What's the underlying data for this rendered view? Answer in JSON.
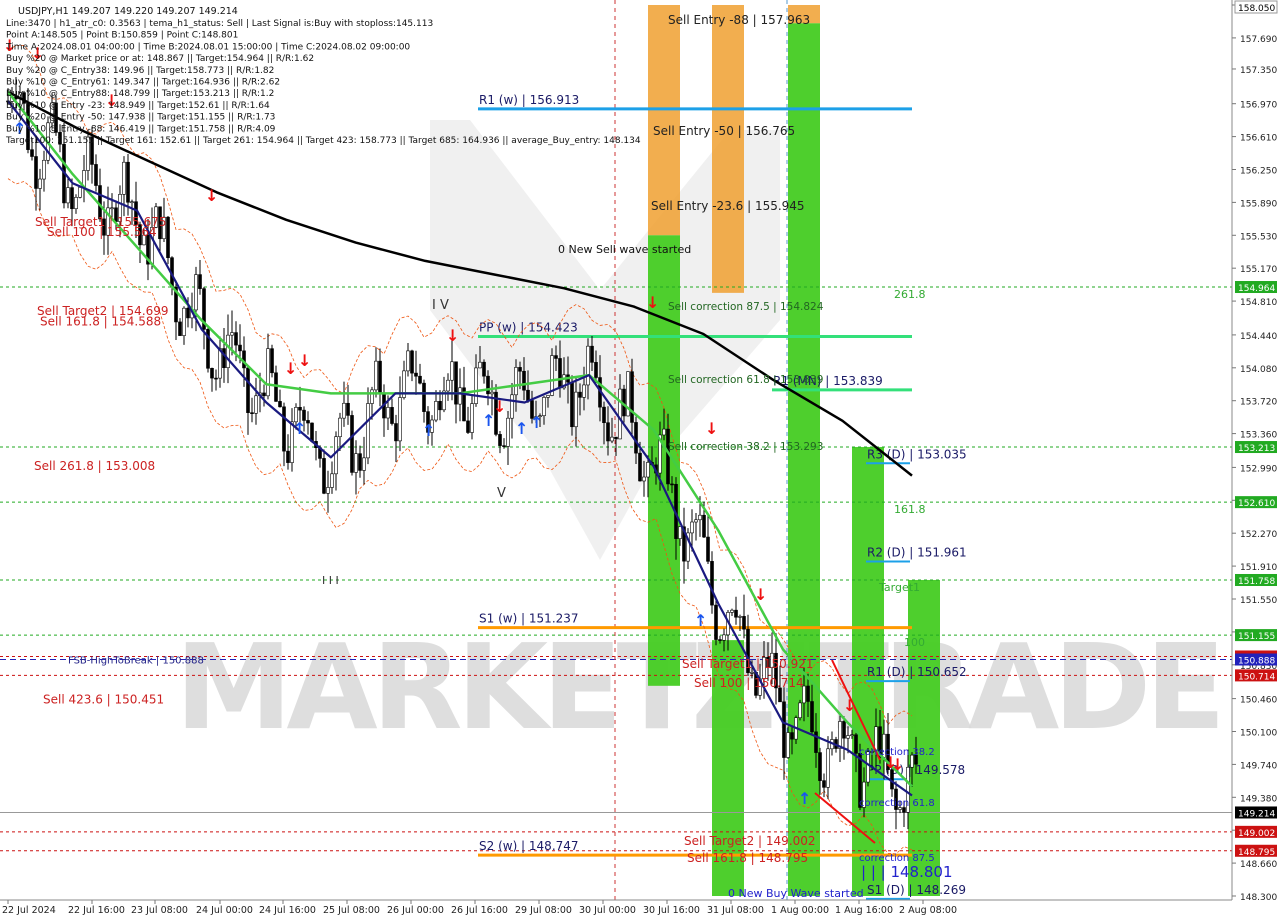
{
  "window": {
    "symbol_line": "USDJPY,H1  149.207 149.220 149.207 149.214"
  },
  "info_lines": [
    "Line:3470  | h1_atr_c0: 0.3563  | tema_h1_status: Sell  | Last Signal is:Buy with stoploss:145.113",
    "Point A:148.505  | Point B:150.859  | Point C:148.801",
    "Time A:2024.08.01 04:00:00  | Time B:2024.08.01 15:00:00  | Time C:2024.08.02 09:00:00",
    "Buy %20 @ Market price or at: 148.867  || Target:154.964  || R/R:1.62",
    "Buy %20 @ C_Entry38: 149.96  || Target:158.773  || R/R:1.82",
    "Buy %10 @ C_Entry61: 149.347  || Target:164.936  || R/R:2.62",
    "Buy %10 @ C_Entry88: 148.799  || Target:153.213  || R/R:1.2",
    "Buy %10 @ Entry -23: 148.949  || Target:152.61  || R/R:1.64",
    "Buy %20 @ Entry -50: 147.938  || Target:151.155  || R/R:1.73",
    "Buy %10 @ Entry -88: 146.419  || Target:151.758  || R/R:4.09",
    "Target100: 151.155  || Target 161: 152.61  || Target 261: 154.964  || Target 423: 158.773  || Target 685: 164.936  || average_Buy_entry: 148.134"
  ],
  "chart_data": {
    "type": "candlestick",
    "symbol": "USDJPY",
    "timeframe": "H1",
    "bid": 149.214,
    "price_axis": {
      "min": 148.3,
      "max": 158.05,
      "ticks": [
        158.05,
        157.69,
        157.35,
        156.97,
        156.61,
        156.25,
        155.89,
        155.53,
        155.17,
        154.81,
        154.44,
        154.08,
        153.72,
        153.36,
        152.99,
        152.63,
        152.27,
        151.91,
        151.55,
        151.19,
        150.83,
        150.46,
        150.1,
        149.74,
        149.38,
        149.02,
        148.66,
        148.3
      ]
    },
    "time_axis": [
      "22 Jul 2024",
      "22 Jul 16:00",
      "23 Jul 08:00",
      "24 Jul 00:00",
      "24 Jul 16:00",
      "25 Jul 08:00",
      "26 Jul 00:00",
      "26 Jul 16:00",
      "29 Jul 08:00",
      "30 Jul 00:00",
      "30 Jul 16:00",
      "31 Jul 08:00",
      "1 Aug 00:00",
      "1 Aug 16:00",
      "2 Aug 08:00"
    ],
    "price_tags": [
      {
        "value": "158.050",
        "color": "#ffffff",
        "text": "#000000"
      },
      {
        "value": "154.964",
        "color": "#22aa22",
        "text": "#ffffff"
      },
      {
        "value": "153.213",
        "color": "#22aa22",
        "text": "#ffffff"
      },
      {
        "value": "152.610",
        "color": "#22aa22",
        "text": "#ffffff"
      },
      {
        "value": "151.758",
        "color": "#22aa22",
        "text": "#ffffff"
      },
      {
        "value": "151.155",
        "color": "#22aa22",
        "text": "#ffffff"
      },
      {
        "value": "150.921",
        "color": "#cc1111",
        "text": "#ffffff"
      },
      {
        "value": "150.888",
        "color": "#2222bb",
        "text": "#ffffff"
      },
      {
        "value": "150.714",
        "color": "#cc1111",
        "text": "#ffffff"
      },
      {
        "value": "149.214",
        "color": "#000000",
        "text": "#ffffff"
      },
      {
        "value": "149.002",
        "color": "#cc1111",
        "text": "#ffffff"
      },
      {
        "value": "148.795",
        "color": "#cc1111",
        "text": "#ffffff"
      }
    ],
    "horizontal_lines": [
      {
        "price": 154.964,
        "style": "dotted",
        "color": "#22aa22"
      },
      {
        "price": 153.213,
        "style": "dotted",
        "color": "#22aa22"
      },
      {
        "price": 152.61,
        "style": "dotted",
        "color": "#22aa22"
      },
      {
        "price": 151.758,
        "style": "dotted",
        "color": "#22aa22"
      },
      {
        "price": 151.155,
        "style": "dotted",
        "color": "#22aa22"
      },
      {
        "price": 150.921,
        "style": "dotted",
        "color": "#cc1111"
      },
      {
        "price": 150.888,
        "style": "dashed",
        "color": "#2222bb"
      },
      {
        "price": 150.714,
        "style": "dotted",
        "color": "#cc1111"
      },
      {
        "price": 149.214,
        "style": "solid",
        "color": "#999999"
      },
      {
        "price": 149.002,
        "style": "dotted",
        "color": "#cc1111"
      },
      {
        "price": 148.795,
        "style": "dotted",
        "color": "#cc1111"
      }
    ],
    "levels": [
      {
        "label": "R1 (w) | 156.913",
        "price": 156.913,
        "color": "#1ca0e8",
        "from": "26 Jul 16:00",
        "to": "1 Aug 16:00"
      },
      {
        "label": "PP (w) | 154.423",
        "price": 154.423,
        "color": "#33e07a",
        "from": "26 Jul 16:00",
        "to": "1 Aug 16:00"
      },
      {
        "label": "S1 (w) | 151.237",
        "price": 151.237,
        "color": "#ff9a00",
        "from": "26 Jul 16:00",
        "to": "1 Aug 16:00"
      },
      {
        "label": "S2 (w) | 148.747",
        "price": 148.747,
        "color": "#ff9a00",
        "from": "26 Jul 16:00",
        "to": "1 Aug 16:00"
      },
      {
        "label": "R1 (MN) | 153.839",
        "price": 153.839,
        "color": "#33e07a",
        "from": "31 Jul 08:00",
        "to": "1 Aug 16:00"
      },
      {
        "label": "R3 (D) | 153.035",
        "price": 153.035,
        "color": "#1ca0e8",
        "from": "1 Aug 16:00",
        "to": "2 Aug 08:00"
      },
      {
        "label": "R2 (D) | 151.961",
        "price": 151.961,
        "color": "#1ca0e8",
        "from": "1 Aug 16:00",
        "to": "2 Aug 08:00"
      },
      {
        "label": "R1 (D) | 150.652",
        "price": 150.652,
        "color": "#1ca0e8",
        "from": "1 Aug 16:00",
        "to": "2 Aug 08:00"
      },
      {
        "label": "PP (D) | 149.578",
        "price": 149.578,
        "color": "#1ca0e8",
        "from": "1 Aug 16:00",
        "to": "2 Aug 08:00"
      },
      {
        "label": "S1 (D) | 148.269",
        "price": 148.269,
        "color": "#1ca0e8",
        "from": "1 Aug 16:00",
        "to": "2 Aug 08:00"
      }
    ],
    "left_labels": [
      {
        "text": "Sell Target1 | 155.675",
        "price": 155.675,
        "color": "#cc2222"
      },
      {
        "text": "Sell 100 | 155.564",
        "price": 155.564,
        "color": "#cc2222"
      },
      {
        "text": "Sell Target2 | 154.699",
        "price": 154.699,
        "color": "#cc2222"
      },
      {
        "text": "Sell 161.8 | 154.588",
        "price": 154.588,
        "color": "#cc2222"
      },
      {
        "text": "Sell  261.8 | 153.008",
        "price": 153.008,
        "color": "#cc2222"
      },
      {
        "text": "FSB-HighToBreak | 150.888",
        "price": 150.888,
        "color": "#222288"
      },
      {
        "text": "Sell  423.6 | 150.451",
        "price": 150.451,
        "color": "#cc2222"
      }
    ],
    "annotations": [
      {
        "text": "Sell Entry -88 | 157.963",
        "color": "#222222"
      },
      {
        "text": "Sell Entry -50 | 156.765",
        "color": "#222222"
      },
      {
        "text": "Sell Entry -23.6 | 155.945",
        "color": "#222222"
      },
      {
        "text": "0 New Sell wave started",
        "color": "#111111"
      },
      {
        "text": "Sell correction 87.5 | 154.824",
        "color": "#226622"
      },
      {
        "text": "Sell correction 61.8 | 153.839",
        "color": "#226622"
      },
      {
        "text": "Sell correction 38.2 | 153.293",
        "color": "#226622"
      },
      {
        "text": "261.8",
        "color": "#33aa33"
      },
      {
        "text": "161.8",
        "color": "#33aa33"
      },
      {
        "text": "Target1",
        "color": "#33aa33"
      },
      {
        "text": "100",
        "color": "#33aa33"
      },
      {
        "text": "Sell Target1 | 150.921",
        "color": "#cc2222"
      },
      {
        "text": "Sell 100 | 150.714",
        "color": "#cc2222"
      },
      {
        "text": "Sell Target2 | 149.002",
        "color": "#cc2222"
      },
      {
        "text": "Sell 161.8 | 148.795",
        "color": "#cc2222"
      },
      {
        "text": "correction 38.2",
        "color": "#2222cc"
      },
      {
        "text": "correction 61.8",
        "color": "#2222cc"
      },
      {
        "text": "correction 87.5",
        "color": "#2222cc"
      },
      {
        "text": "| | | 148.801",
        "color": "#2222cc"
      },
      {
        "text": "0 New Buy Wave started",
        "color": "#2222cc"
      },
      {
        "text": "V",
        "color": "#333333"
      },
      {
        "text": "I V",
        "color": "#333333"
      },
      {
        "text": "I I I",
        "color": "#333333"
      }
    ],
    "zones": [
      {
        "kind": "sell_entry",
        "color": "#f0a030",
        "x_from": "30 Jul 16:00",
        "x_to": "30 Jul 22:00",
        "price_from": 155.53,
        "price_to": 158.05
      },
      {
        "kind": "sell_entry",
        "color": "#f0a030",
        "x_from": "31 Jul 08:00",
        "x_to": "31 Jul 14:00",
        "price_from": 154.9,
        "price_to": 158.05
      },
      {
        "kind": "sell_entry",
        "color": "#f0a030",
        "x_from": "1 Aug 03:00",
        "x_to": "1 Aug 09:00",
        "price_from": 157.85,
        "price_to": 158.05
      },
      {
        "kind": "buy_target",
        "color": "#44cc22",
        "x_from": "30 Jul 16:00",
        "x_to": "30 Jul 22:00",
        "price_from": 150.6,
        "price_to": 155.53
      },
      {
        "kind": "buy_target",
        "color": "#44cc22",
        "x_from": "31 Jul 08:00",
        "x_to": "31 Jul 14:00",
        "price_from": 148.3,
        "price_to": 151.1
      },
      {
        "kind": "buy_target",
        "color": "#44cc22",
        "x_from": "1 Aug 03:00",
        "x_to": "1 Aug 09:00",
        "price_from": 148.3,
        "price_to": 157.85
      },
      {
        "kind": "buy_target",
        "color": "#44cc22",
        "x_from": "1 Aug 19:00",
        "x_to": "2 Aug 01:00",
        "price_from": 148.3,
        "price_to": 153.213
      },
      {
        "kind": "buy_target",
        "color": "#44cc22",
        "x_from": "2 Aug 09:00",
        "x_to": "2 Aug 15:00",
        "price_from": 148.3,
        "price_to": 151.758
      }
    ],
    "series": [
      {
        "name": "MA slow",
        "color": "#000000",
        "values": [
          157.1,
          156.7,
          156.35,
          156.0,
          155.7,
          155.45,
          155.25,
          155.1,
          154.95,
          154.75,
          154.45,
          153.95,
          153.5,
          152.9
        ]
      },
      {
        "name": "MA mid",
        "color": "#44cc44",
        "values": [
          157.1,
          156.2,
          155.4,
          154.6,
          153.9,
          153.8,
          153.8,
          153.8,
          153.9,
          154.0,
          153.4,
          152.3,
          151.0,
          150.2,
          149.5
        ]
      },
      {
        "name": "MA fast",
        "color": "#1a1a80",
        "values": [
          157.0,
          156.1,
          155.8,
          154.5,
          153.7,
          153.1,
          153.8,
          153.8,
          153.7,
          154.0,
          153.0,
          151.5,
          150.2,
          149.9,
          149.4
        ]
      }
    ],
    "watermark": "MARKETZITRADE"
  }
}
